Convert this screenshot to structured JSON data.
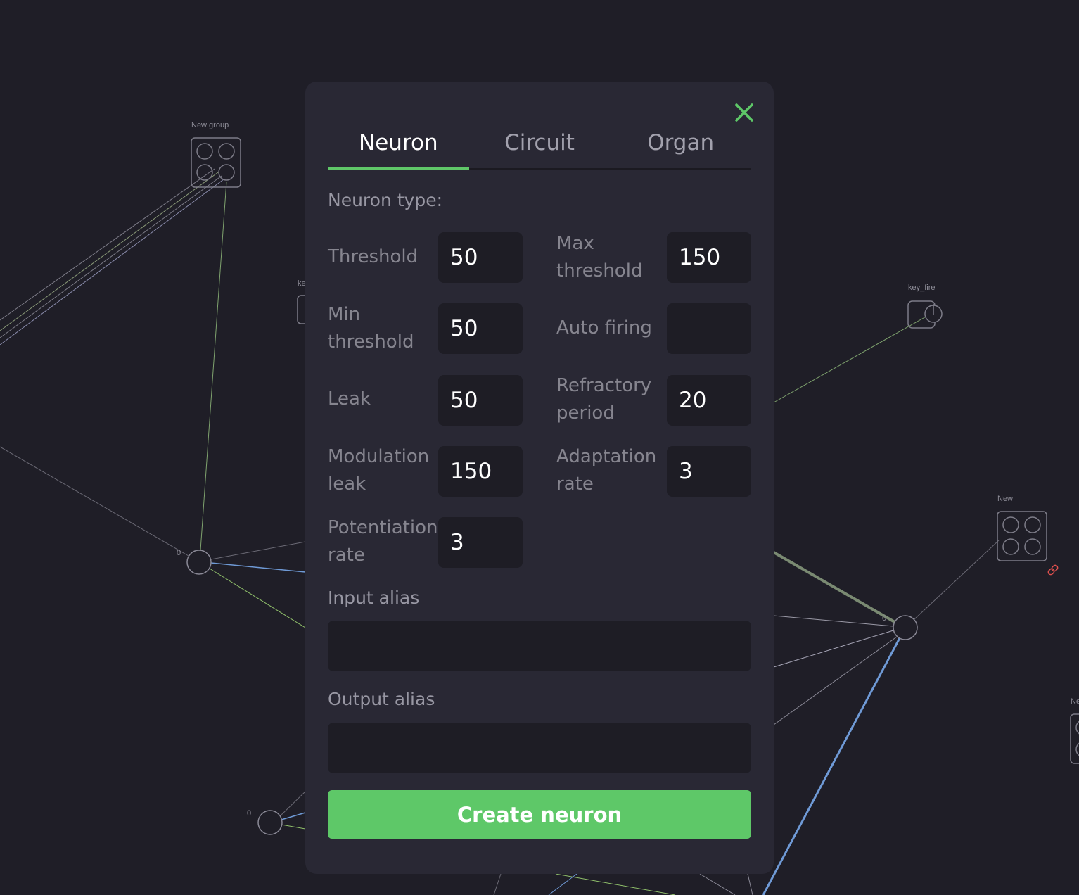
{
  "canvas": {
    "node_labels": {
      "group_top_left": "New group",
      "key_fire": "key_fire",
      "group_right": "New",
      "partial_left": "ke",
      "partial_right": "Ne",
      "neuron_left_value": "0",
      "neuron_right_value": "0",
      "neuron_bottom_value": "0"
    }
  },
  "modal": {
    "close_icon": "close-icon",
    "tabs": [
      {
        "label": "Neuron",
        "active": true
      },
      {
        "label": "Circuit",
        "active": false
      },
      {
        "label": "Organ",
        "active": false
      }
    ],
    "neuron_type_label": "Neuron type:",
    "fields": {
      "threshold": {
        "label": "Threshold",
        "value": "50"
      },
      "max_threshold": {
        "label": "Max threshold",
        "value": "150"
      },
      "min_threshold": {
        "label": "Min threshold",
        "value": "50"
      },
      "auto_firing": {
        "label": "Auto firing",
        "value": ""
      },
      "leak": {
        "label": "Leak",
        "value": "50"
      },
      "refractory_period": {
        "label": "Refractory period",
        "value": "20"
      },
      "modulation_leak": {
        "label": "Modulation leak",
        "value": "150"
      },
      "adaptation_rate": {
        "label": "Adaptation rate",
        "value": "3"
      },
      "potentiation_rate": {
        "label": "Potentiation rate",
        "value": "3"
      }
    },
    "input_alias_label": "Input alias",
    "input_alias_value": "",
    "output_alias_label": "Output alias",
    "output_alias_value": "",
    "create_button_label": "Create neuron"
  },
  "colors": {
    "background": "#1f1e27",
    "modal": "#292834",
    "field": "#1e1d25",
    "accent_green": "#5ec868",
    "edge_blue": "#6f9ad6",
    "edge_green": "#8fbf6a",
    "edge_grey": "#8a8996",
    "link_red": "#e0504e"
  }
}
